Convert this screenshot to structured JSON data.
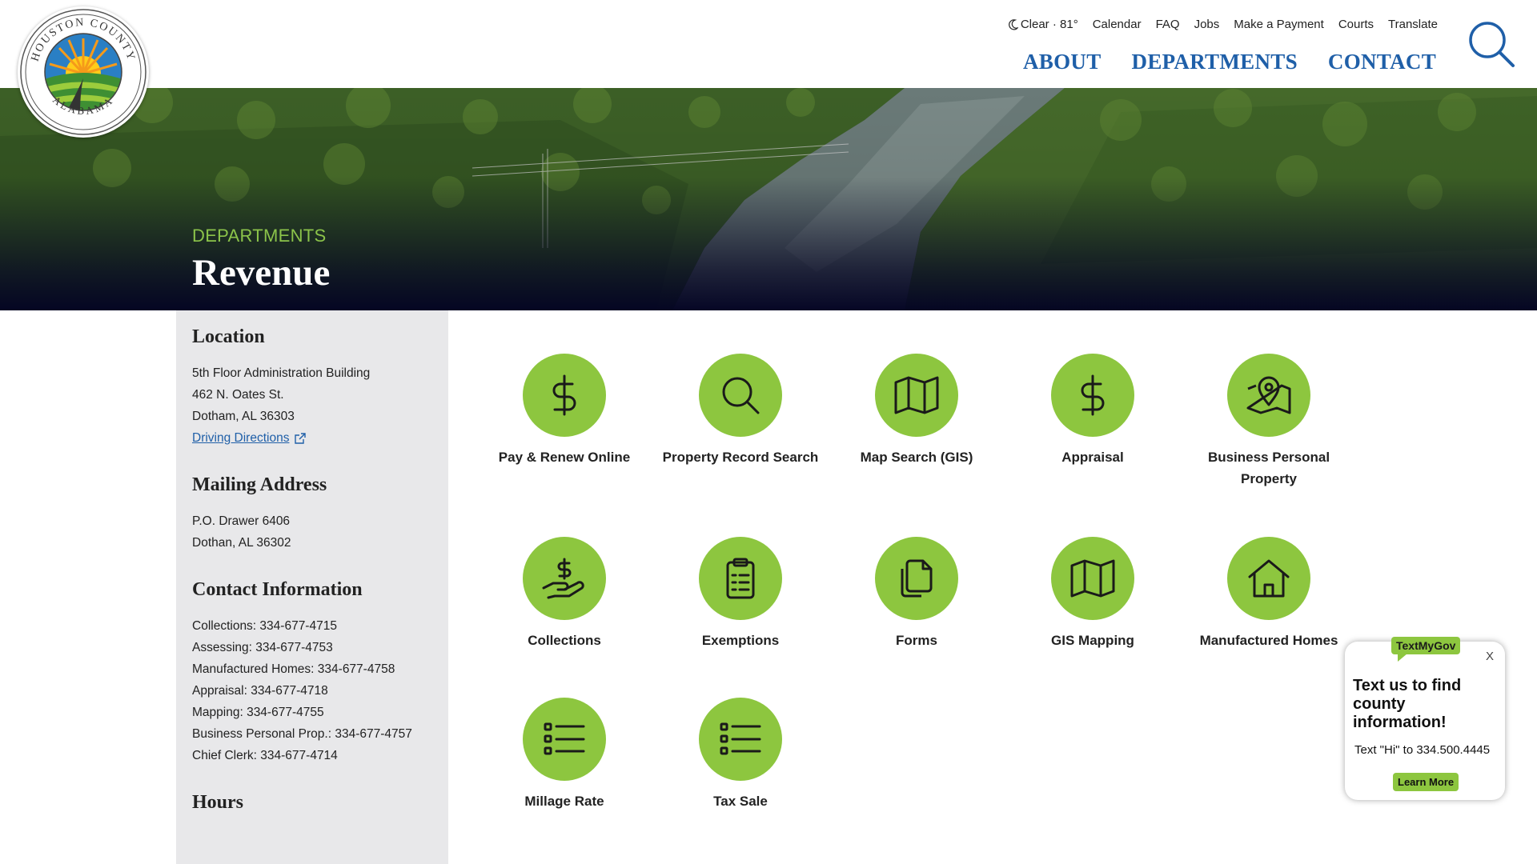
{
  "header": {
    "weather": "Clear · 81°",
    "utility_links": [
      "Calendar",
      "FAQ",
      "Jobs",
      "Make a Payment",
      "Courts",
      "Translate"
    ],
    "main_nav": [
      "ABOUT",
      "DEPARTMENTS",
      "CONTACT"
    ],
    "logo_top_text": "HOUSTON COUNTY",
    "logo_bottom_text": "ALABAMA"
  },
  "hero": {
    "kicker": "DEPARTMENTS",
    "title": "Revenue"
  },
  "sidebar": {
    "location": {
      "heading": "Location",
      "lines": [
        "5th Floor Administration Building",
        "462 N. Oates St.",
        "Dotham, AL 36303"
      ],
      "directions_label": "Driving Directions"
    },
    "mailing": {
      "heading": "Mailing Address",
      "lines": [
        "P.O. Drawer 6406",
        "Dothan, AL 36302"
      ]
    },
    "contact": {
      "heading": "Contact Information",
      "lines": [
        "Collections: 334-677-4715",
        "Assessing: 334-677-4753",
        "Manufactured Homes: 334-677-4758",
        "Appraisal: 334-677-4718",
        "Mapping: 334-677-4755",
        "Business Personal Prop.: 334-677-4757",
        "Chief Clerk: 334-677-4714"
      ]
    },
    "hours": {
      "heading": "Hours"
    }
  },
  "tiles": [
    {
      "label": "Pay & Renew Online",
      "icon": "dollar-icon"
    },
    {
      "label": "Property Record Search",
      "icon": "search-icon"
    },
    {
      "label": "Map Search (GIS)",
      "icon": "map-icon"
    },
    {
      "label": "Appraisal",
      "icon": "dollar-icon"
    },
    {
      "label": "Business Personal Property",
      "icon": "map-pin-icon"
    },
    {
      "label": "Collections",
      "icon": "hand-dollar-icon"
    },
    {
      "label": "Exemptions",
      "icon": "clipboard-icon"
    },
    {
      "label": "Forms",
      "icon": "documents-icon"
    },
    {
      "label": "GIS Mapping",
      "icon": "map-icon"
    },
    {
      "label": "Manufactured Homes",
      "icon": "home-icon"
    },
    {
      "label": "Millage Rate",
      "icon": "list-icon"
    },
    {
      "label": "Tax Sale",
      "icon": "list-icon"
    }
  ],
  "widget": {
    "badge": "TextMyGov",
    "close": "X",
    "title": "Text us to find county information!",
    "body": "Text \"Hi\" to 334.500.4445",
    "button": "Learn More"
  },
  "colors": {
    "accent_green": "#8dc63f",
    "nav_blue": "#1f5fa8",
    "sidebar_gray": "#e8e8ea",
    "hero_dark": "#060a2a"
  }
}
